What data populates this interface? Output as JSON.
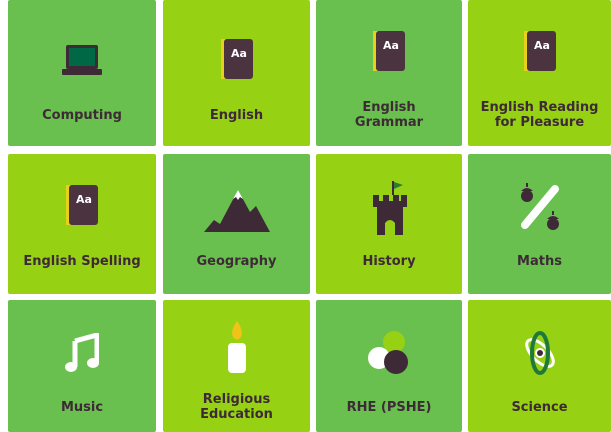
{
  "subjects": [
    {
      "label": "Computing",
      "icon": "laptop-icon"
    },
    {
      "label": "English",
      "icon": "book-icon",
      "book_text": "Aa"
    },
    {
      "label": "English\nGrammar",
      "icon": "book-icon",
      "book_text": "Aa"
    },
    {
      "label": "English Reading\nfor Pleasure",
      "icon": "book-icon",
      "book_text": "Aa"
    },
    {
      "label": "English Spelling",
      "icon": "book-icon",
      "book_text": "Aa"
    },
    {
      "label": "Geography",
      "icon": "mountain-icon"
    },
    {
      "label": "History",
      "icon": "castle-icon"
    },
    {
      "label": "Maths",
      "icon": "percent-acorn-icon"
    },
    {
      "label": "Music",
      "icon": "music-note-icon"
    },
    {
      "label": "Religious\nEducation",
      "icon": "candle-icon"
    },
    {
      "label": "RHE (PSHE)",
      "icon": "venn-circles-icon"
    },
    {
      "label": "Science",
      "icon": "atom-icon"
    }
  ],
  "colors": {
    "tile_lime": "#97d114",
    "tile_green": "#6ac04f",
    "text_dark": "#3d2a36",
    "book_cover": "#4b3340",
    "laptop_screen": "#006845"
  }
}
